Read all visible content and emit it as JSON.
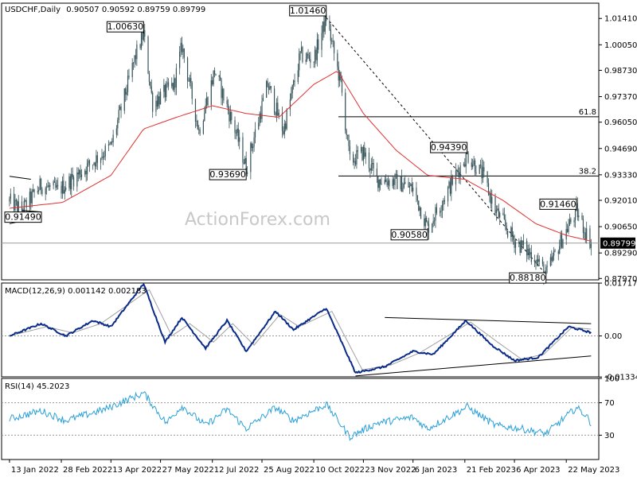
{
  "header": {
    "symbol": "USDCHF,Daily",
    "ohlc": "0.90507 0.90592 0.89759 0.89799"
  },
  "watermark": "ActionForex.com",
  "colors": {
    "candles": "#36545a",
    "sma": "#e03030",
    "macd": "#0a2a8a",
    "signal": "#a0a0a0",
    "rsi": "#2aa0d8",
    "hline": "#000000"
  },
  "chart_data": [
    {
      "type": "candlestick",
      "panel": "price",
      "ylim": [
        0.879,
        1.022
      ],
      "y_ticks": [
        "1.01410",
        "1.00050",
        "0.98730",
        "0.97370",
        "0.96050",
        "0.94690",
        "0.93330",
        "0.92010",
        "0.90650",
        "0.89290",
        "0.87970"
      ],
      "x_ticks": [
        "13 Jan 2022",
        "28 Feb 2022",
        "13 Apr 2022",
        "27 May 2022",
        "12 Jul 2022",
        "25 Aug 2022",
        "10 Oct 2022",
        "23 Nov 2022",
        "6 Jan 2023",
        "21 Feb 2023",
        "6 Apr 2023",
        "22 May 2023"
      ],
      "current_price_label": "0.89799",
      "price_keypoints": [
        {
          "date": "2022-01-13",
          "value": 0.9195
        },
        {
          "date": "2022-01-24",
          "value": 0.9149
        },
        {
          "date": "2022-02-10",
          "value": 0.928
        },
        {
          "date": "2022-02-25",
          "value": 0.925
        },
        {
          "date": "2022-03-22",
          "value": 0.937
        },
        {
          "date": "2022-04-13",
          "value": 0.948
        },
        {
          "date": "2022-05-05",
          "value": 0.995
        },
        {
          "date": "2022-05-12",
          "value": 1.0063
        },
        {
          "date": "2022-05-20",
          "value": 0.97
        },
        {
          "date": "2022-06-08",
          "value": 0.98
        },
        {
          "date": "2022-06-15",
          "value": 1.0
        },
        {
          "date": "2022-06-30",
          "value": 0.956
        },
        {
          "date": "2022-07-14",
          "value": 0.987
        },
        {
          "date": "2022-08-02",
          "value": 0.955
        },
        {
          "date": "2022-08-11",
          "value": 0.9369
        },
        {
          "date": "2022-08-30",
          "value": 0.98
        },
        {
          "date": "2022-09-13",
          "value": 0.956
        },
        {
          "date": "2022-09-28",
          "value": 0.995
        },
        {
          "date": "2022-10-10",
          "value": 0.993
        },
        {
          "date": "2022-10-21",
          "value": 1.0146
        },
        {
          "date": "2022-11-03",
          "value": 0.98
        },
        {
          "date": "2022-11-11",
          "value": 0.94
        },
        {
          "date": "2022-11-23",
          "value": 0.945
        },
        {
          "date": "2022-12-05",
          "value": 0.931
        },
        {
          "date": "2022-12-21",
          "value": 0.93
        },
        {
          "date": "2023-01-06",
          "value": 0.926
        },
        {
          "date": "2023-01-19",
          "value": 0.9058
        },
        {
          "date": "2023-02-01",
          "value": 0.92
        },
        {
          "date": "2023-02-23",
          "value": 0.9439
        },
        {
          "date": "2023-03-09",
          "value": 0.933
        },
        {
          "date": "2023-03-20",
          "value": 0.915
        },
        {
          "date": "2023-04-05",
          "value": 0.9
        },
        {
          "date": "2023-04-25",
          "value": 0.89
        },
        {
          "date": "2023-05-04",
          "value": 0.8818
        },
        {
          "date": "2023-05-18",
          "value": 0.9
        },
        {
          "date": "2023-05-31",
          "value": 0.9146
        },
        {
          "date": "2023-06-08",
          "value": 0.904
        },
        {
          "date": "2023-06-13",
          "value": 0.898
        }
      ],
      "sma_keypoints": [
        {
          "date": "2022-01-13",
          "value": 0.916
        },
        {
          "date": "2022-03-01",
          "value": 0.919
        },
        {
          "date": "2022-04-13",
          "value": 0.933
        },
        {
          "date": "2022-05-12",
          "value": 0.957
        },
        {
          "date": "2022-06-10",
          "value": 0.963
        },
        {
          "date": "2022-07-12",
          "value": 0.969
        },
        {
          "date": "2022-08-11",
          "value": 0.965
        },
        {
          "date": "2022-09-09",
          "value": 0.963
        },
        {
          "date": "2022-10-10",
          "value": 0.98
        },
        {
          "date": "2022-10-31",
          "value": 0.987
        },
        {
          "date": "2022-11-23",
          "value": 0.965
        },
        {
          "date": "2022-12-22",
          "value": 0.946
        },
        {
          "date": "2023-01-19",
          "value": 0.933
        },
        {
          "date": "2023-02-21",
          "value": 0.931
        },
        {
          "date": "2023-03-27",
          "value": 0.92
        },
        {
          "date": "2023-04-25",
          "value": 0.908
        },
        {
          "date": "2023-05-22",
          "value": 0.902
        },
        {
          "date": "2023-06-13",
          "value": 0.899
        }
      ],
      "annotations": [
        {
          "date": "2022-01-24",
          "value": 0.9149,
          "text": "0.91490"
        },
        {
          "date": "2022-05-12",
          "value": 1.0063,
          "text": "1.00630"
        },
        {
          "date": "2022-08-11",
          "value": 0.9369,
          "text": "0.93690"
        },
        {
          "date": "2022-10-21",
          "value": 1.0146,
          "text": "1.01460"
        },
        {
          "date": "2023-01-19",
          "value": 0.9058,
          "text": "0.90580"
        },
        {
          "date": "2023-02-23",
          "value": 0.9439,
          "text": "0.94390"
        },
        {
          "date": "2023-05-04",
          "value": 0.8818,
          "text": "0.88180"
        },
        {
          "date": "2023-05-31",
          "value": 0.9146,
          "text": "0.91460"
        }
      ],
      "fib_levels": [
        {
          "text": "61.8",
          "value": 0.9633
        },
        {
          "text": "38.2",
          "value": 0.9327
        }
      ],
      "horizontal_line": 0.898,
      "trendline": [
        {
          "date": "2022-10-21",
          "value": 1.0146
        },
        {
          "date": "2023-05-04",
          "value": 0.8818
        }
      ],
      "channel_lines": [
        [
          {
            "date": "2022-01-13",
            "value": 0.9325
          },
          {
            "date": "2022-02-01",
            "value": 0.931
          }
        ],
        [
          {
            "date": "2022-01-13",
            "value": 0.908
          },
          {
            "date": "2022-02-01",
            "value": 0.9105
          }
        ]
      ]
    },
    {
      "type": "line",
      "panel": "macd",
      "title": "MACD(12,26,9) 0.001142 0.002183",
      "ylim": [
        -0.0133,
        0.0172
      ],
      "y_ticks": [
        "0.017176",
        "0.00",
        "-0.013344"
      ],
      "series": [
        {
          "name": "MACD",
          "values": [
            {
              "date": "2022-01-13",
              "value": 0.0
            },
            {
              "date": "2022-02-10",
              "value": 0.004
            },
            {
              "date": "2022-03-04",
              "value": 0.0
            },
            {
              "date": "2022-03-28",
              "value": 0.005
            },
            {
              "date": "2022-04-13",
              "value": 0.003
            },
            {
              "date": "2022-05-12",
              "value": 0.017
            },
            {
              "date": "2022-05-31",
              "value": -0.002
            },
            {
              "date": "2022-06-15",
              "value": 0.006
            },
            {
              "date": "2022-07-06",
              "value": -0.004
            },
            {
              "date": "2022-07-25",
              "value": 0.005
            },
            {
              "date": "2022-08-11",
              "value": -0.005
            },
            {
              "date": "2022-09-06",
              "value": 0.008
            },
            {
              "date": "2022-09-22",
              "value": 0.002
            },
            {
              "date": "2022-10-21",
              "value": 0.009
            },
            {
              "date": "2022-11-16",
              "value": -0.012
            },
            {
              "date": "2022-12-12",
              "value": -0.01
            },
            {
              "date": "2023-01-06",
              "value": -0.005
            },
            {
              "date": "2023-01-24",
              "value": -0.006
            },
            {
              "date": "2023-02-22",
              "value": 0.005
            },
            {
              "date": "2023-03-17",
              "value": -0.003
            },
            {
              "date": "2023-04-06",
              "value": -0.008
            },
            {
              "date": "2023-04-27",
              "value": -0.007
            },
            {
              "date": "2023-05-24",
              "value": 0.003
            },
            {
              "date": "2023-06-13",
              "value": 0.0011
            }
          ]
        },
        {
          "name": "Signal",
          "values": [
            {
              "date": "2022-01-13",
              "value": 0.0
            },
            {
              "date": "2022-02-15",
              "value": 0.003
            },
            {
              "date": "2022-03-10",
              "value": 0.001
            },
            {
              "date": "2022-04-04",
              "value": 0.004
            },
            {
              "date": "2022-05-17",
              "value": 0.015
            },
            {
              "date": "2022-06-06",
              "value": 0.0
            },
            {
              "date": "2022-06-22",
              "value": 0.004
            },
            {
              "date": "2022-07-13",
              "value": -0.002
            },
            {
              "date": "2022-07-30",
              "value": 0.004
            },
            {
              "date": "2022-08-18",
              "value": -0.003
            },
            {
              "date": "2022-09-10",
              "value": 0.007
            },
            {
              "date": "2022-09-27",
              "value": 0.003
            },
            {
              "date": "2022-10-26",
              "value": 0.008
            },
            {
              "date": "2022-11-22",
              "value": -0.011
            },
            {
              "date": "2022-12-17",
              "value": -0.0095
            },
            {
              "date": "2023-01-12",
              "value": -0.0055
            },
            {
              "date": "2023-02-26",
              "value": 0.0045
            },
            {
              "date": "2023-03-22",
              "value": -0.002
            },
            {
              "date": "2023-04-12",
              "value": -0.0075
            },
            {
              "date": "2023-05-02",
              "value": -0.006
            },
            {
              "date": "2023-05-27",
              "value": 0.0028
            },
            {
              "date": "2023-06-13",
              "value": 0.0022
            }
          ]
        }
      ],
      "trendlines": [
        [
          {
            "date": "2022-12-12",
            "value": 0.006
          },
          {
            "date": "2023-06-13",
            "value": 0.004
          }
        ],
        [
          {
            "date": "2022-11-16",
            "value": -0.013
          },
          {
            "date": "2023-06-13",
            "value": -0.0065
          }
        ]
      ]
    },
    {
      "type": "line",
      "panel": "rsi",
      "title": "RSI(14) 45.2023",
      "ylim": [
        0,
        100
      ],
      "y_ticks": [
        "100",
        "70",
        "30",
        "0"
      ],
      "levels": [
        70,
        30
      ],
      "series": [
        {
          "name": "RSI",
          "values": [
            {
              "date": "2022-01-13",
              "value": 50
            },
            {
              "date": "2022-02-10",
              "value": 60
            },
            {
              "date": "2022-03-04",
              "value": 48
            },
            {
              "date": "2022-04-08",
              "value": 62
            },
            {
              "date": "2022-05-12",
              "value": 82
            },
            {
              "date": "2022-06-01",
              "value": 45
            },
            {
              "date": "2022-06-15",
              "value": 66
            },
            {
              "date": "2022-07-06",
              "value": 42
            },
            {
              "date": "2022-07-25",
              "value": 62
            },
            {
              "date": "2022-08-11",
              "value": 38
            },
            {
              "date": "2022-09-06",
              "value": 64
            },
            {
              "date": "2022-09-22",
              "value": 48
            },
            {
              "date": "2022-10-21",
              "value": 68
            },
            {
              "date": "2022-11-11",
              "value": 28
            },
            {
              "date": "2022-12-05",
              "value": 45
            },
            {
              "date": "2023-01-06",
              "value": 52
            },
            {
              "date": "2023-01-19",
              "value": 38
            },
            {
              "date": "2023-02-23",
              "value": 65
            },
            {
              "date": "2023-03-20",
              "value": 42
            },
            {
              "date": "2023-04-12",
              "value": 38
            },
            {
              "date": "2023-05-04",
              "value": 32
            },
            {
              "date": "2023-05-31",
              "value": 64
            },
            {
              "date": "2023-06-08",
              "value": 55
            },
            {
              "date": "2023-06-13",
              "value": 45
            }
          ]
        }
      ]
    }
  ]
}
